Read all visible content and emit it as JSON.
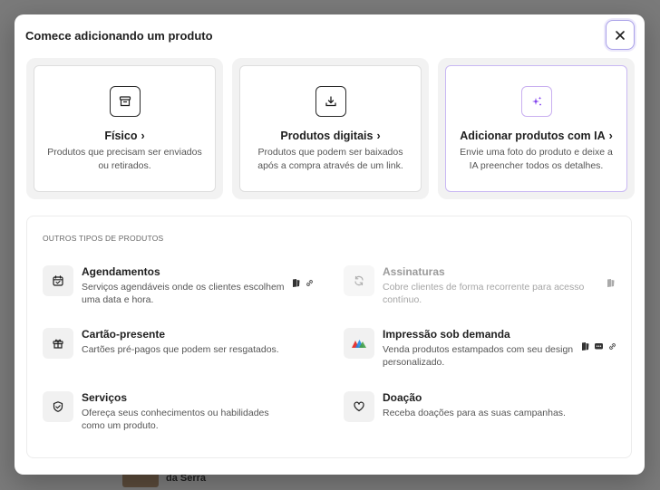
{
  "modal": {
    "title": "Comece adicionando um produto"
  },
  "cards": [
    {
      "title": "Físico",
      "desc": "Produtos que precisam ser enviados ou retirados.",
      "icon": "box-icon"
    },
    {
      "title": "Produtos digitais",
      "desc": "Produtos que podem ser baixados após a compra através de um link.",
      "icon": "download-icon"
    },
    {
      "title": "Adicionar produtos com IA",
      "desc": "Envie uma foto do produto e deixe a IA preencher todos os detalhes.",
      "icon": "sparkle-icon"
    }
  ],
  "others": {
    "heading": "OUTROS TIPOS DE PRODUTOS",
    "items": [
      {
        "title": "Agendamentos",
        "desc": "Serviços agendáveis onde os clientes escolhem uma data e hora.",
        "icon": "calendar-icon"
      },
      {
        "title": "Assinaturas",
        "desc": "Cobre clientes de forma recorrente para acesso contínuo.",
        "icon": "refresh-icon"
      },
      {
        "title": "Cartão-presente",
        "desc": "Cartões pré-pagos que podem ser resgatados.",
        "icon": "gift-icon"
      },
      {
        "title": "Impressão sob demanda",
        "desc": "Venda produtos estampados com seu design personalizado.",
        "icon": "print-logo-icon"
      },
      {
        "title": "Serviços",
        "desc": "Ofereça seus conhecimentos ou habilidades como um produto.",
        "icon": "shield-icon"
      },
      {
        "title": "Doação",
        "desc": "Receba doações para as suas campanhas.",
        "icon": "heart-icon"
      }
    ]
  },
  "background": {
    "item_label": "da Serra"
  },
  "colors": {
    "accent": "#7c3aed",
    "close_border": "#a9a0e8"
  }
}
